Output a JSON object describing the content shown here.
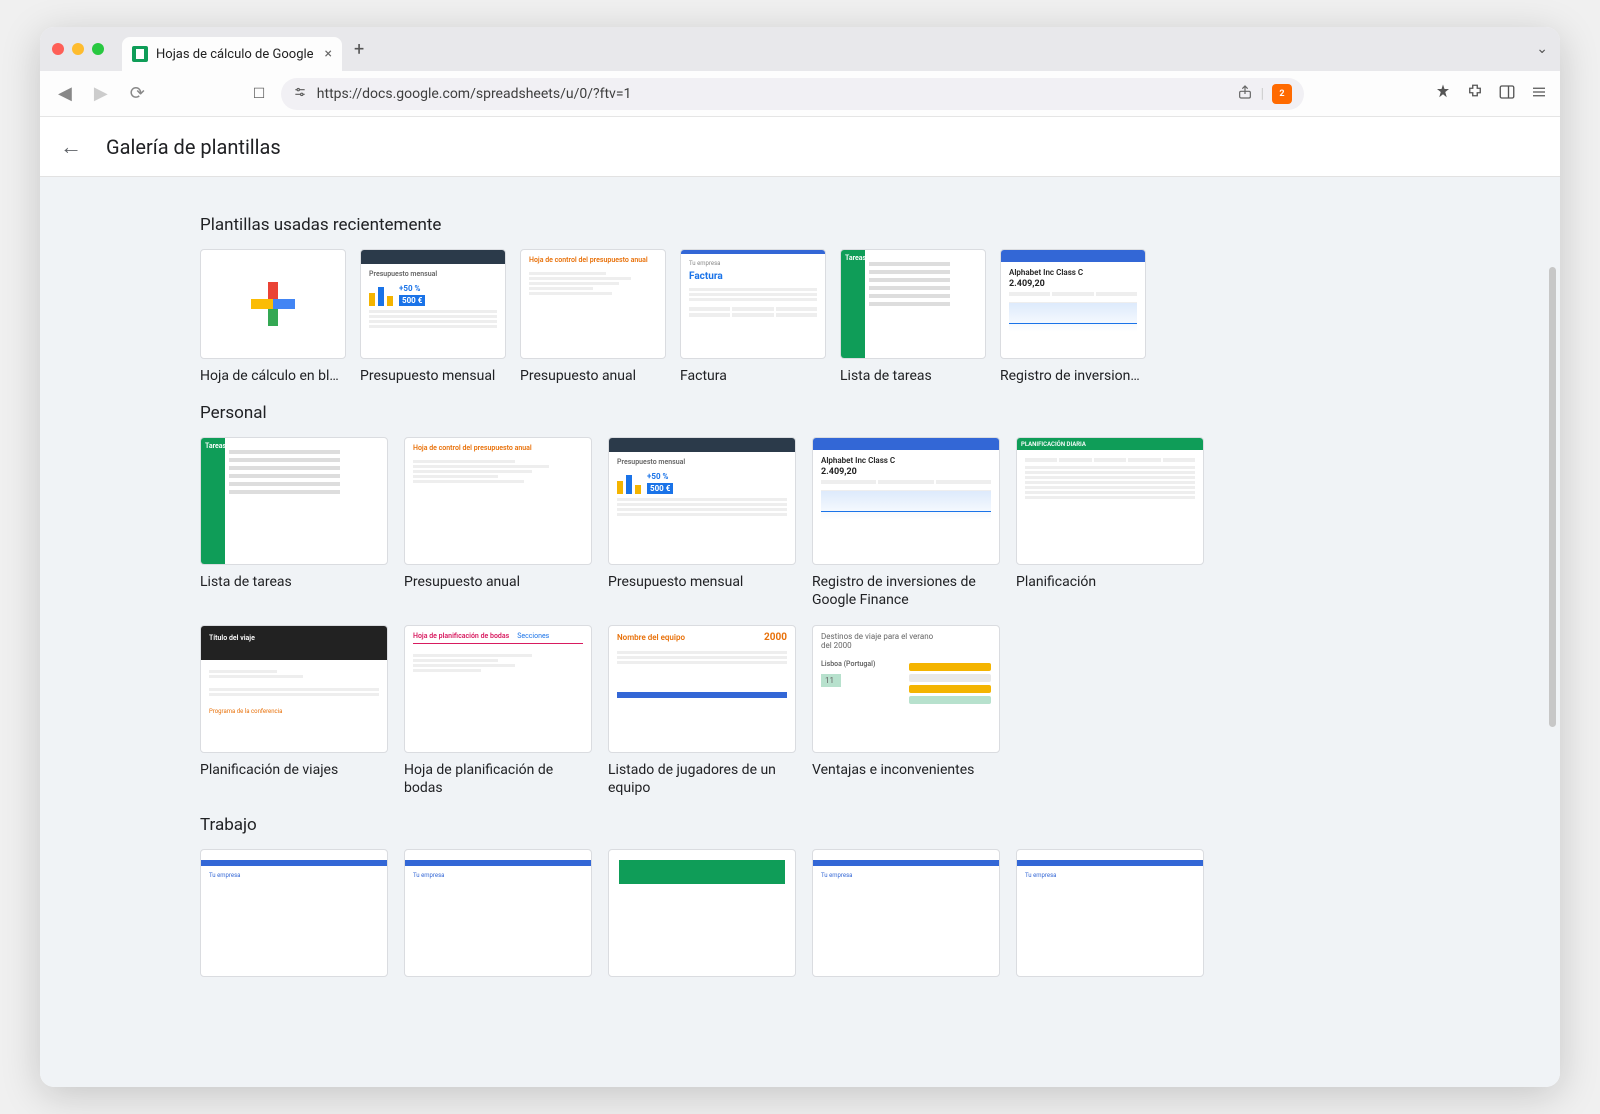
{
  "browser": {
    "tab_title": "Hojas de cálculo de Google",
    "url": "https://docs.google.com/spreadsheets/u/0/?ftv=1",
    "shield_badge": "2"
  },
  "header": {
    "title": "Galería de plantillas"
  },
  "sections": [
    {
      "title": "Plantillas usadas recientemente",
      "layout": "six",
      "items": [
        {
          "label": "Hoja de cálculo en bla...",
          "thumb": "blank"
        },
        {
          "label": "Presupuesto mensual",
          "thumb": "budget-monthly"
        },
        {
          "label": "Presupuesto anual",
          "thumb": "budget-annual"
        },
        {
          "label": "Factura",
          "thumb": "invoice"
        },
        {
          "label": "Lista de tareas",
          "thumb": "todo"
        },
        {
          "label": "Registro de inversione...",
          "thumb": "investments"
        }
      ]
    },
    {
      "title": "Personal",
      "layout": "five",
      "items": [
        {
          "label": "Lista de tareas",
          "thumb": "todo"
        },
        {
          "label": "Presupuesto anual",
          "thumb": "budget-annual"
        },
        {
          "label": "Presupuesto mensual",
          "thumb": "budget-monthly"
        },
        {
          "label": "Registro de inversiones de Google Finance",
          "thumb": "investments"
        },
        {
          "label": "Planificación",
          "thumb": "schedule"
        },
        {
          "label": "Planificación de viajes",
          "thumb": "travel"
        },
        {
          "label": "Hoja de planificación de bodas",
          "thumb": "wedding"
        },
        {
          "label": "Listado de jugadores de un equipo",
          "thumb": "team-roster"
        },
        {
          "label": "Ventajas e inconvenientes",
          "thumb": "pros-cons"
        }
      ]
    },
    {
      "title": "Trabajo",
      "layout": "five",
      "items": [
        {
          "label": "",
          "thumb": "work-blue"
        },
        {
          "label": "",
          "thumb": "work-blue"
        },
        {
          "label": "",
          "thumb": "work-green"
        },
        {
          "label": "",
          "thumb": "work-blue"
        },
        {
          "label": "",
          "thumb": "work-blue"
        }
      ]
    }
  ],
  "thumb_text": {
    "budget_monthly_title": "Presupuesto mensual",
    "budget_monthly_pct": "+50 %",
    "budget_monthly_amt": "500 €",
    "budget_annual_title": "Hoja de control del presupuesto anual",
    "invoice_company": "Tu empresa",
    "invoice_title": "Factura",
    "todo_title": "Tareas",
    "investments_title": "Alphabet Inc Class C",
    "investments_value": "2.409,20",
    "schedule_title": "PLANIFICACIÓN DIARIA",
    "travel_title": "Título del viaje",
    "travel_footer": "Programa de la conferencia",
    "wedding_title": "Hoja de planificación de bodas",
    "wedding_sections": "Secciones",
    "roster_title": "Nombre del equipo",
    "roster_year": "2000",
    "pros_title": "Destinos de viaje para el verano del 2000",
    "pros_city": "Lisboa (Portugal)",
    "pros_num": "11",
    "work_company": "Tu empresa"
  }
}
